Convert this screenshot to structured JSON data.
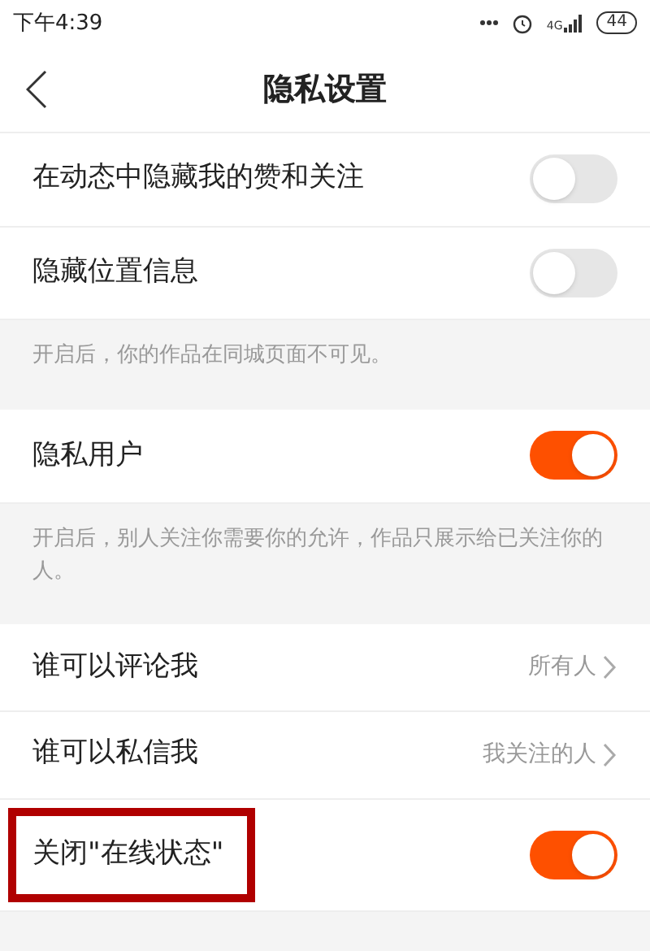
{
  "status_bar": {
    "time": "下午4:39",
    "network": "4G",
    "battery": "44"
  },
  "header": {
    "title": "隐私设置"
  },
  "items": [
    {
      "kind": "toggle",
      "label": "在动态中隐藏我的赞和关注",
      "on": false
    },
    {
      "kind": "toggle",
      "label": "隐藏位置信息",
      "on": false
    },
    {
      "kind": "hint",
      "text": "开启后，你的作品在同城页面不可见。"
    },
    {
      "kind": "toggle",
      "label": "隐私用户",
      "on": true
    },
    {
      "kind": "hint",
      "text": "开启后，别人关注你需要你的允许，作品只展示给已关注你的人。"
    },
    {
      "kind": "link",
      "label": "谁可以评论我",
      "value": "所有人"
    },
    {
      "kind": "link",
      "label": "谁可以私信我",
      "value": "我关注的人"
    },
    {
      "kind": "toggle",
      "label": "关闭\"在线状态\"",
      "on": true,
      "highlighted": true
    },
    {
      "kind": "hint"
    }
  ]
}
